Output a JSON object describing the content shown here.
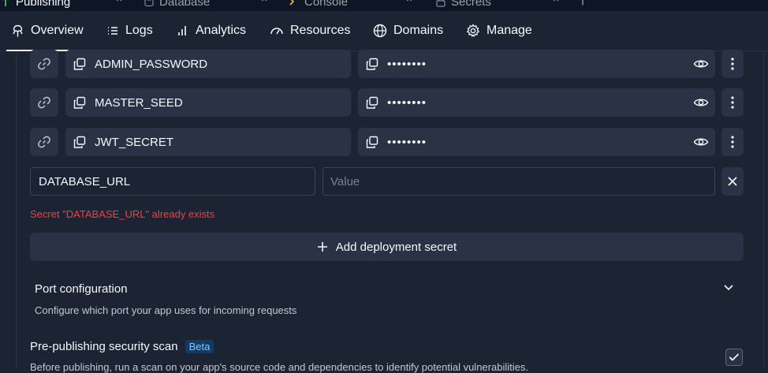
{
  "window_tabs": [
    {
      "label": "Publishing",
      "icon": "publishing-icon",
      "active": true
    },
    {
      "label": "Database",
      "icon": "database-icon",
      "active": false
    },
    {
      "label": "Console",
      "icon": "console-icon",
      "active": false
    },
    {
      "label": "Secrets",
      "icon": "secrets-icon",
      "active": false
    }
  ],
  "nav": {
    "items": [
      {
        "label": "Overview",
        "icon": "publishing-icon",
        "active": true
      },
      {
        "label": "Logs",
        "icon": "list-icon"
      },
      {
        "label": "Analytics",
        "icon": "bar-chart-icon"
      },
      {
        "label": "Resources",
        "icon": "gauge-icon"
      },
      {
        "label": "Domains",
        "icon": "globe-icon"
      },
      {
        "label": "Manage",
        "icon": "gear-icon"
      }
    ]
  },
  "secrets": [
    {
      "key": "ADMIN_PASSWORD",
      "value": "••••••••"
    },
    {
      "key": "MASTER_SEED",
      "value": "••••••••"
    },
    {
      "key": "JWT_SECRET",
      "value": "••••••••"
    }
  ],
  "new_secret": {
    "key_value": "DATABASE_URL",
    "value_placeholder": "Value",
    "error": "Secret \"DATABASE_URL\" already exists"
  },
  "add_secret_label": "Add deployment secret",
  "port": {
    "title": "Port configuration",
    "description": "Configure which port your app uses for incoming requests"
  },
  "scan": {
    "title": "Pre-publishing security scan",
    "badge": "Beta",
    "description": "Before publishing, run a scan on your app's source code and dependencies to identify potential vulnerabilities.",
    "checked": true
  },
  "colors": {
    "background": "#1c2333",
    "surface": "#2b3245",
    "error": "#f23f3f",
    "badge_bg": "#0f3b66",
    "badge_fg": "#8fc5ff"
  }
}
